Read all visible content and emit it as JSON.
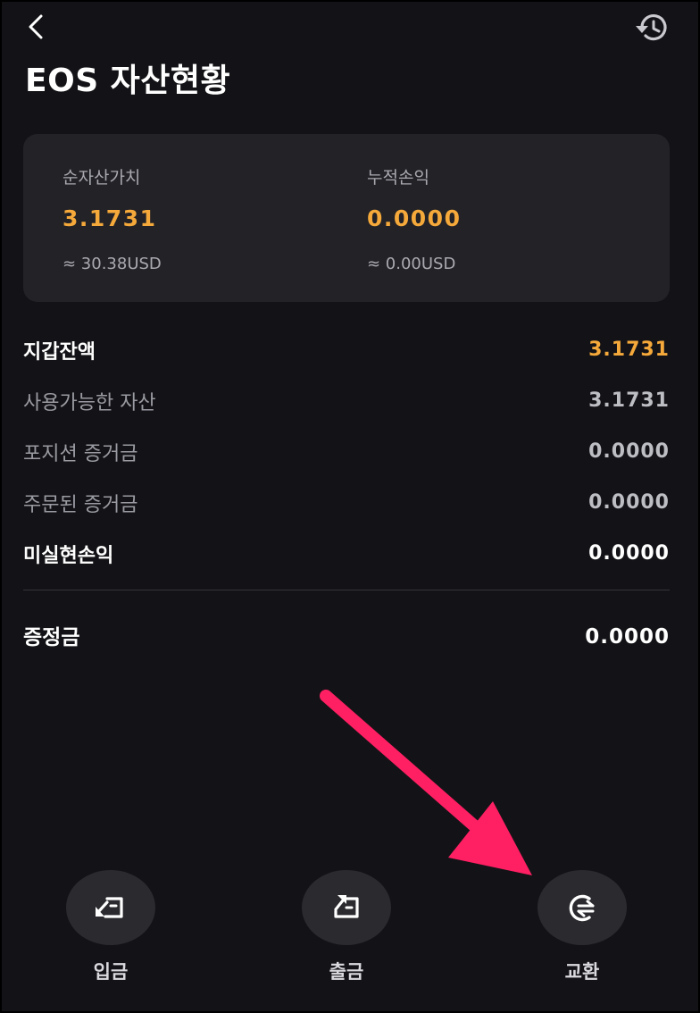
{
  "header": {
    "back_icon": "chevron-left-icon",
    "history_icon": "history-icon",
    "title": "EOS 자산현황"
  },
  "summary": {
    "net_asset": {
      "label": "순자산가치",
      "value": "3.1731",
      "usd": "≈ 30.38USD"
    },
    "cumulative_pnl": {
      "label": "누적손익",
      "value": "0.0000",
      "usd": "≈ 0.00USD"
    }
  },
  "rows": [
    {
      "label": "지갑잔액",
      "value": "3.1731"
    },
    {
      "label": "사용가능한 자산",
      "value": "3.1731"
    },
    {
      "label": "포지션 증거금",
      "value": "0.0000"
    },
    {
      "label": "주문된 증거금",
      "value": "0.0000"
    },
    {
      "label": "미실현손익",
      "value": "0.0000"
    }
  ],
  "margin": {
    "label": "증정금",
    "value": "0.0000"
  },
  "actions": [
    {
      "label": "입금",
      "icon": "deposit-icon"
    },
    {
      "label": "출금",
      "icon": "withdraw-icon"
    },
    {
      "label": "교환",
      "icon": "exchange-icon"
    }
  ],
  "colors": {
    "background": "#131317",
    "card": "#222227",
    "accent": "#f5a93a",
    "annotation_arrow": "#ff1f63"
  }
}
